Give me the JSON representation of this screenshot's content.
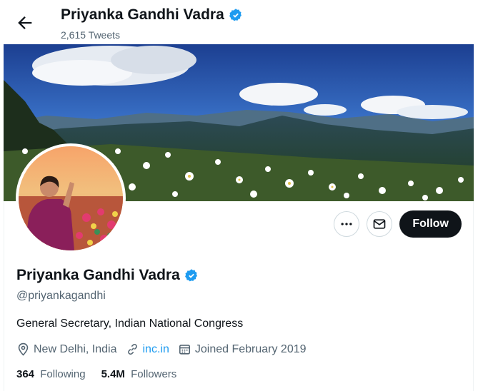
{
  "header": {
    "name": "Priyanka Gandhi Vadra",
    "tweet_count": "2,615 Tweets"
  },
  "profile": {
    "name": "Priyanka Gandhi Vadra",
    "handle": "@priyankagandhi",
    "bio": "General Secretary, Indian National Congress",
    "location": "New Delhi, India",
    "website": "inc.in",
    "joined": "Joined February 2019",
    "following_count": "364",
    "following_label": "Following",
    "followers_count": "5.4M",
    "followers_label": "Followers"
  },
  "actions": {
    "follow_label": "Follow"
  },
  "icons": {
    "back": "back-arrow-icon",
    "verified": "verified-badge-icon",
    "more": "more-icon",
    "message": "envelope-icon",
    "location": "location-pin-icon",
    "link": "link-icon",
    "calendar": "calendar-icon"
  },
  "colors": {
    "accent": "#1d9bf0",
    "text": "#0f1419",
    "secondary": "#536471",
    "follow_bg": "#0f1419"
  }
}
